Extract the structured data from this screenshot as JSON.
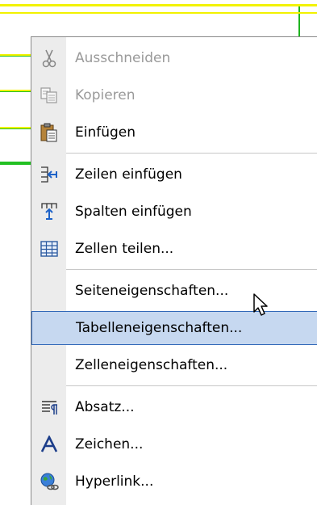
{
  "menu": {
    "items": [
      {
        "label": "Ausschneiden",
        "icon": "scissors-icon",
        "enabled": false
      },
      {
        "label": "Kopieren",
        "icon": "copy-icon",
        "enabled": false
      },
      {
        "label": "Einfügen",
        "icon": "clipboard-paste-icon",
        "enabled": true
      },
      {
        "label": "Zeilen einfügen",
        "icon": "insert-rows-icon",
        "enabled": true
      },
      {
        "label": "Spalten einfügen",
        "icon": "insert-columns-icon",
        "enabled": true
      },
      {
        "label": "Zellen teilen...",
        "icon": "split-cells-icon",
        "enabled": true
      },
      {
        "label": "Seiteneigenschaften...",
        "icon": "",
        "enabled": true
      },
      {
        "label": "Tabelleneigenschaften...",
        "icon": "",
        "enabled": true,
        "highlighted": true
      },
      {
        "label": "Zelleneigenschaften...",
        "icon": "",
        "enabled": true
      },
      {
        "label": "Absatz...",
        "icon": "paragraph-icon",
        "enabled": true
      },
      {
        "label": "Zeichen...",
        "icon": "font-icon",
        "enabled": true
      },
      {
        "label": "Hyperlink...",
        "icon": "hyperlink-globe-icon",
        "enabled": true
      }
    ]
  },
  "colors": {
    "highlight_bg": "#c6d8f0",
    "highlight_border": "#3168b8",
    "table_border_yellow": "#f2f200",
    "table_border_green": "#22c022"
  }
}
